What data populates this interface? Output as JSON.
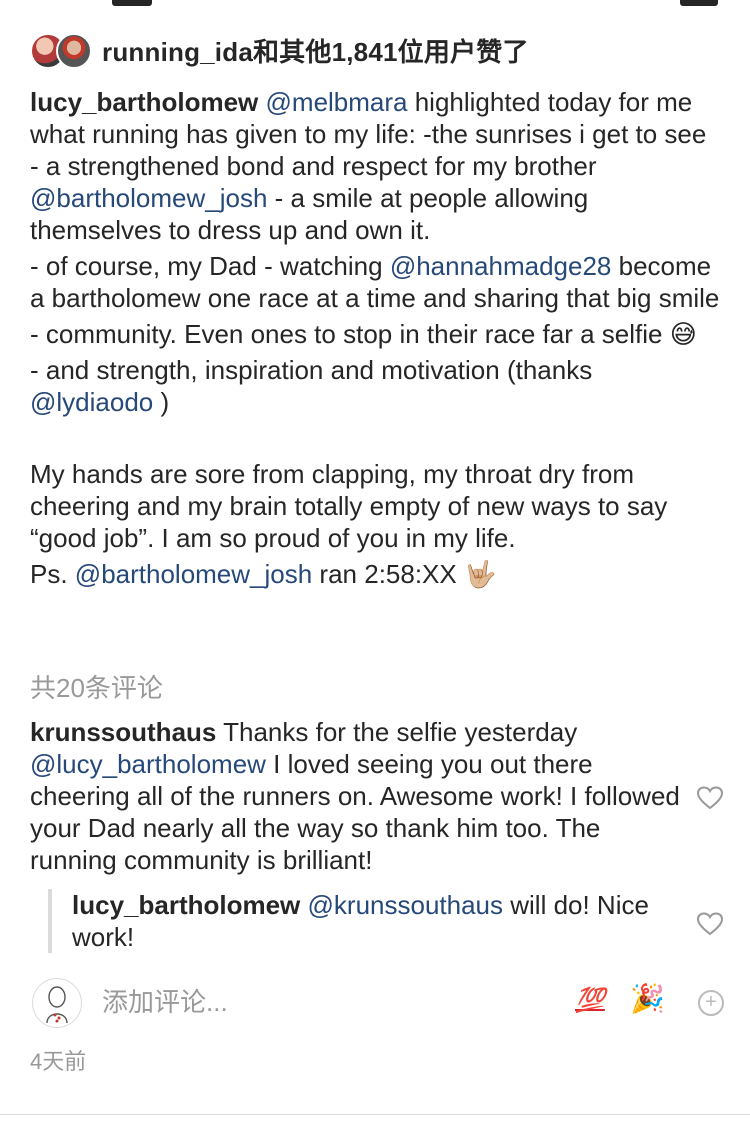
{
  "likes": {
    "text": "running_ida和其他1,841位用户赞了"
  },
  "caption": {
    "username": "lucy_bartholomew",
    "p1": [
      {
        "t": "text",
        "v": " "
      },
      {
        "t": "mention",
        "v": "@melbmara"
      },
      {
        "t": "text",
        "v": " highlighted today for me what running has given to my life: -the sunrises i get to see - a strengthened bond and respect for my brother "
      },
      {
        "t": "mention",
        "v": "@bartholomew_josh"
      },
      {
        "t": "text",
        "v": " - a smile at people allowing themselves to dress up and own it."
      }
    ],
    "p2": [
      {
        "t": "text",
        "v": "- of course, my Dad - watching "
      },
      {
        "t": "mention",
        "v": "@hannahmadge28"
      },
      {
        "t": "text",
        "v": " become a bartholomew one race at a time and sharing that big smile"
      }
    ],
    "p3": [
      {
        "t": "text",
        "v": "- community. Even ones to stop in their race far a selfie "
      },
      {
        "t": "emoji",
        "v": "😅"
      }
    ],
    "p4": [
      {
        "t": "text",
        "v": "- and strength, inspiration and motivation (thanks "
      },
      {
        "t": "mention",
        "v": "@lydiaodo"
      },
      {
        "t": "text",
        "v": " )"
      }
    ],
    "p5": [
      {
        "t": "text",
        "v": "My hands are sore from clapping, my throat dry from cheering and my brain totally empty of new ways to say “good job”. I am so proud of you in my life."
      }
    ],
    "p6": [
      {
        "t": "text",
        "v": "Ps. "
      },
      {
        "t": "mention",
        "v": "@bartholomew_josh"
      },
      {
        "t": "text",
        "v": " ran 2:58:XX "
      },
      {
        "t": "emoji",
        "v": "🤟🏼"
      }
    ]
  },
  "comment_count": "共20条评论",
  "comments": [
    {
      "username": "krunssouthaus",
      "parts": [
        {
          "t": "text",
          "v": " Thanks for the selfie yesterday "
        },
        {
          "t": "mention",
          "v": "@lucy_bartholomew"
        },
        {
          "t": "text",
          "v": " I loved seeing you out there cheering all of the runners on. Awesome work! I followed your Dad nearly all the way so thank him too. The running community is brilliant!"
        }
      ]
    }
  ],
  "reply": {
    "username": "lucy_bartholomew",
    "parts": [
      {
        "t": "text",
        "v": " "
      },
      {
        "t": "mention",
        "v": "@krunssouthaus"
      },
      {
        "t": "text",
        "v": " will do! Nice work!"
      }
    ]
  },
  "add_comment": {
    "placeholder": "添加评论...",
    "quick_emoji_1": "💯",
    "quick_emoji_2": "🎉"
  },
  "timestamp": "4天前",
  "icons": {
    "heart": "heart-outline-icon",
    "add": "plus-circle-icon"
  },
  "colors": {
    "mention": "#27497a",
    "muted": "#999999",
    "text": "#262626"
  }
}
